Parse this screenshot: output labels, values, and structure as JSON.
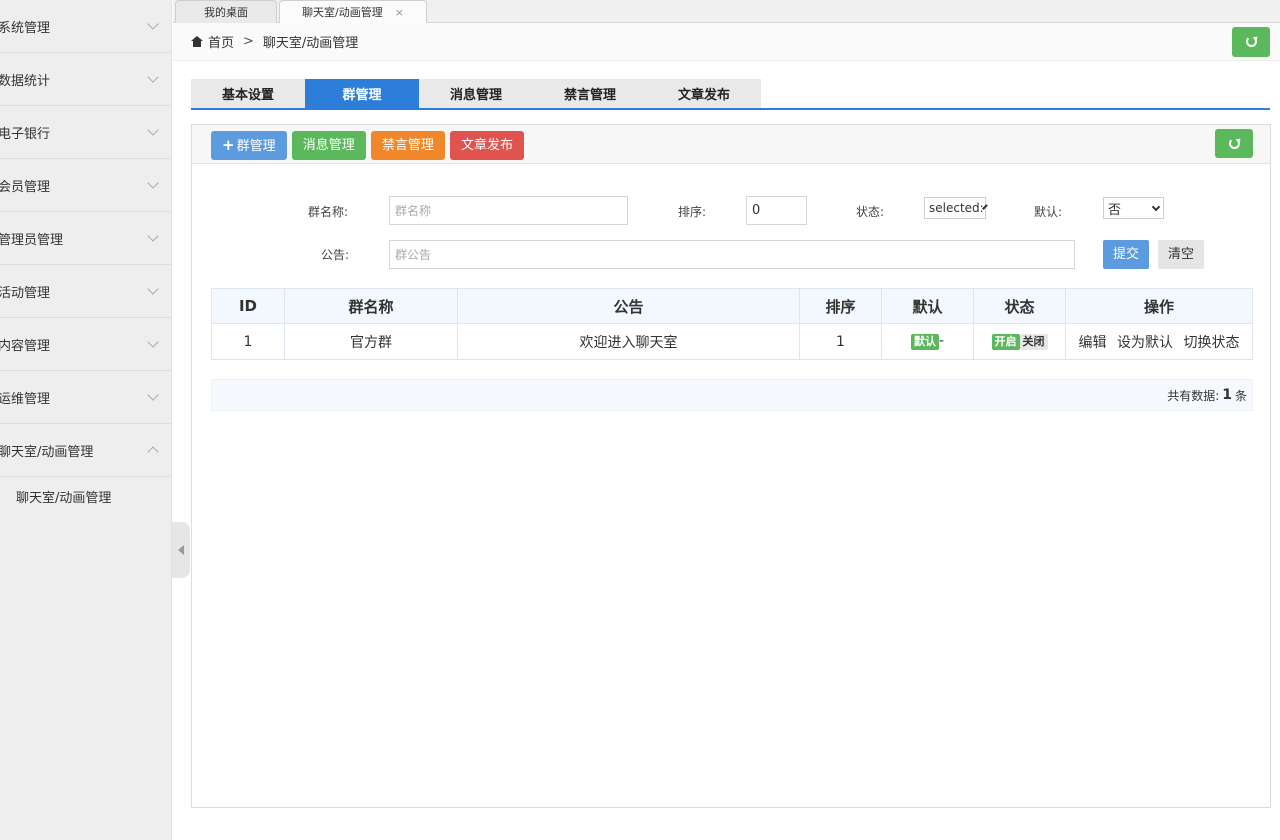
{
  "sidebar": {
    "items": [
      {
        "label": "系统管理"
      },
      {
        "label": "数据统计"
      },
      {
        "label": "电子银行"
      },
      {
        "label": "会员管理"
      },
      {
        "label": "管理员管理"
      },
      {
        "label": "活动管理"
      },
      {
        "label": "内容管理"
      },
      {
        "label": "运维管理"
      },
      {
        "label": "聊天室/动画管理"
      }
    ],
    "submenu": {
      "label": "聊天室/动画管理"
    }
  },
  "page_tabs": [
    {
      "label": "我的桌面"
    },
    {
      "label": "聊天室/动画管理",
      "close": "×"
    }
  ],
  "breadcrumb": {
    "home": "首页",
    "sep": ">",
    "current": "聊天室/动画管理"
  },
  "section_tabs": [
    "基本设置",
    "群管理",
    "消息管理",
    "禁言管理",
    "文章发布"
  ],
  "toolbar": {
    "plus": "+",
    "group_btn": "群管理",
    "message_btn": "消息管理",
    "mute_btn": "禁言管理",
    "article_btn": "文章发布"
  },
  "form": {
    "name_label": "群名称:",
    "name_placeholder": "群名称",
    "sort_label": "排序:",
    "sort_value": "0",
    "status_label": "状态:",
    "status_value": "selected:",
    "default_label": "默认:",
    "default_value": "否",
    "notice_label": "公告:",
    "notice_placeholder": "群公告",
    "submit": "提交",
    "clear": "清空"
  },
  "table": {
    "headers": [
      "ID",
      "群名称",
      "公告",
      "排序",
      "默认",
      "状态",
      "操作"
    ],
    "rows": [
      {
        "id": "1",
        "name": "官方群",
        "notice": "欢迎进入聊天室",
        "sort": "1",
        "default_badge": "默认",
        "default_suffix": "-",
        "status_on": "开启",
        "status_off": "关闭",
        "actions": [
          "编辑",
          "设为默认",
          "切换状态"
        ]
      }
    ]
  },
  "footer": {
    "prefix": "共有数据:",
    "count": "1",
    "suffix": "条"
  },
  "colors": {
    "primary": "#2d7ed8",
    "green": "#5cb85c",
    "orange": "#f0882b",
    "red": "#e0534f",
    "light_blue": "#5b9bde"
  }
}
